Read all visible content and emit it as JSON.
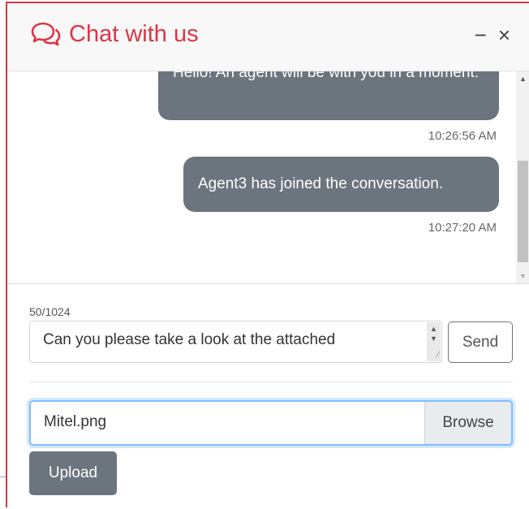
{
  "header": {
    "title": "Chat with us",
    "title_icon": "chat-bubbles-icon",
    "minimize_label": "−",
    "close_label": "×"
  },
  "messages": [
    {
      "text": "Hello! An agent will be with you in a moment.",
      "timestamp": "10:26:56 AM"
    },
    {
      "text": "Agent3 has joined the conversation.",
      "timestamp": "10:27:20 AM"
    }
  ],
  "compose": {
    "char_count": "50/1024",
    "message_value": "Can you please take a look at the attached",
    "send_label": "Send"
  },
  "upload": {
    "file_name": "Mitel.png",
    "browse_label": "Browse",
    "upload_label": "Upload"
  },
  "colors": {
    "accent": "#dc3545",
    "bubble": "#6c757d",
    "focus": "#80bdff"
  }
}
